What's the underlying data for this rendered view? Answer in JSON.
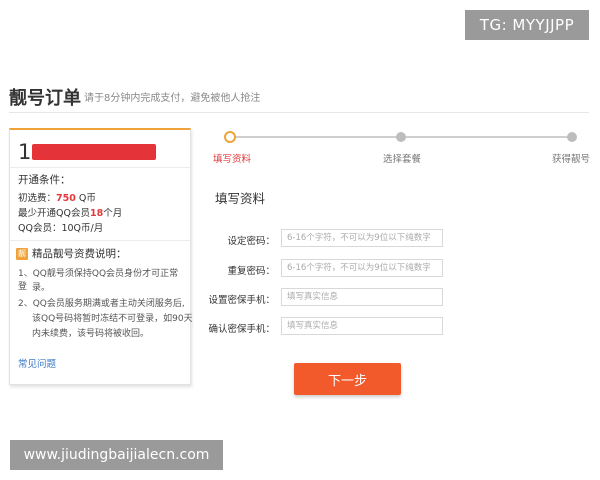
{
  "overlay": {
    "tg_badge": "TG: MYYJJPP",
    "watermark": "www.jiudingbaijialecn.com"
  },
  "header": {
    "title": "靓号订单",
    "subtitle": "请于8分钟内完成支付，避免被他人抢注"
  },
  "left_panel": {
    "number_prefix": "1",
    "conditions_title": "开通条件：",
    "fee_label": "初选费：",
    "fee_value": "750",
    "fee_unit": "Q币",
    "min_label": "最少开通QQ会员",
    "min_value": "18",
    "min_unit": "个月",
    "member_line": "QQ会员：10Q币/月",
    "badge_char": "靓",
    "notes_title": "精品靓号资费说明：",
    "notes": [
      "1、QQ靓号须保持QQ会员身份才可正常登",
      "录。",
      "2、QQ会员服务期满或者主动关闭服务后,",
      "该QQ号码将暂时冻结不可登录，如90天",
      "内未续费，该号码将被收回。"
    ],
    "faq_link": "常见问题"
  },
  "steps": [
    {
      "label": "填写资料",
      "active": true
    },
    {
      "label": "选择套餐",
      "active": false
    },
    {
      "label": "获得靓号",
      "active": false
    }
  ],
  "form": {
    "section_title": "填写资料",
    "fields": [
      {
        "label": "设定密码：",
        "placeholder": "6-16个字符，不可以为9位以下纯数字",
        "value": ""
      },
      {
        "label": "重复密码：",
        "placeholder": "6-16个字符，不可以为9位以下纯数字",
        "value": ""
      },
      {
        "label": "设置密保手机：",
        "placeholder": "填写真实信息",
        "value": ""
      },
      {
        "label": "确认密保手机：",
        "placeholder": "填写真实信息",
        "value": ""
      }
    ],
    "submit_label": "下一步"
  },
  "colors": {
    "accent_orange": "#f0a33a",
    "button_red": "#f25a2c",
    "highlight_red": "#e4393c",
    "link_blue": "#3a78c3"
  }
}
